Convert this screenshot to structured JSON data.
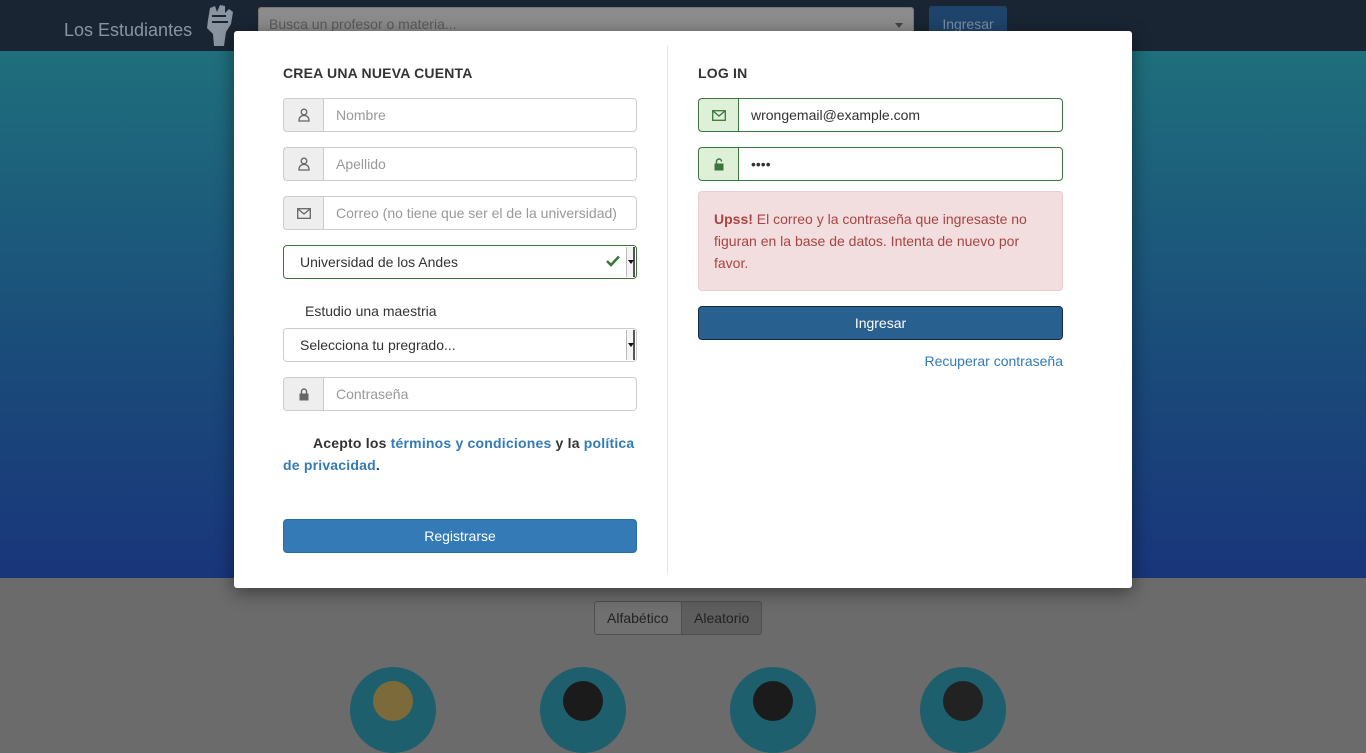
{
  "navbar": {
    "brand": "Los Estudiantes",
    "search_placeholder": "Busca un profesor o materia...",
    "login_label": "Ingresar"
  },
  "sort": {
    "alphabetic": "Alfabético",
    "random": "Aleatorio"
  },
  "signup": {
    "title": "CREA UNA NUEVA CUENTA",
    "name_placeholder": "Nombre",
    "lastname_placeholder": "Apellido",
    "email_placeholder": "Correo (no tiene que ser el de la universidad)",
    "university_value": "Universidad de los Andes",
    "masters_label": "Estudio una maestria",
    "program_value": "Selecciona tu pregrado...",
    "password_placeholder": "Contraseña",
    "terms_prefix": "Acepto los",
    "terms_link": "términos y condiciones",
    "terms_middle": "y la",
    "privacy_link": "política de privacidad",
    "terms_suffix": ".",
    "submit_label": "Registrarse"
  },
  "login": {
    "title": "LOG IN",
    "email_value": "wrongemail@example.com",
    "password_value": "••••",
    "error_strong": "Upss!",
    "error_text": "El correo y la contraseña que ingresaste no figuran en la base de datos. Intenta de nuevo por favor.",
    "submit_label": "Ingresar",
    "recover_link": "Recuperar contraseña"
  },
  "colors": {
    "primary": "#337ab7",
    "success": "#3c763d",
    "danger_text": "#a94442",
    "danger_bg": "#f2dede"
  }
}
